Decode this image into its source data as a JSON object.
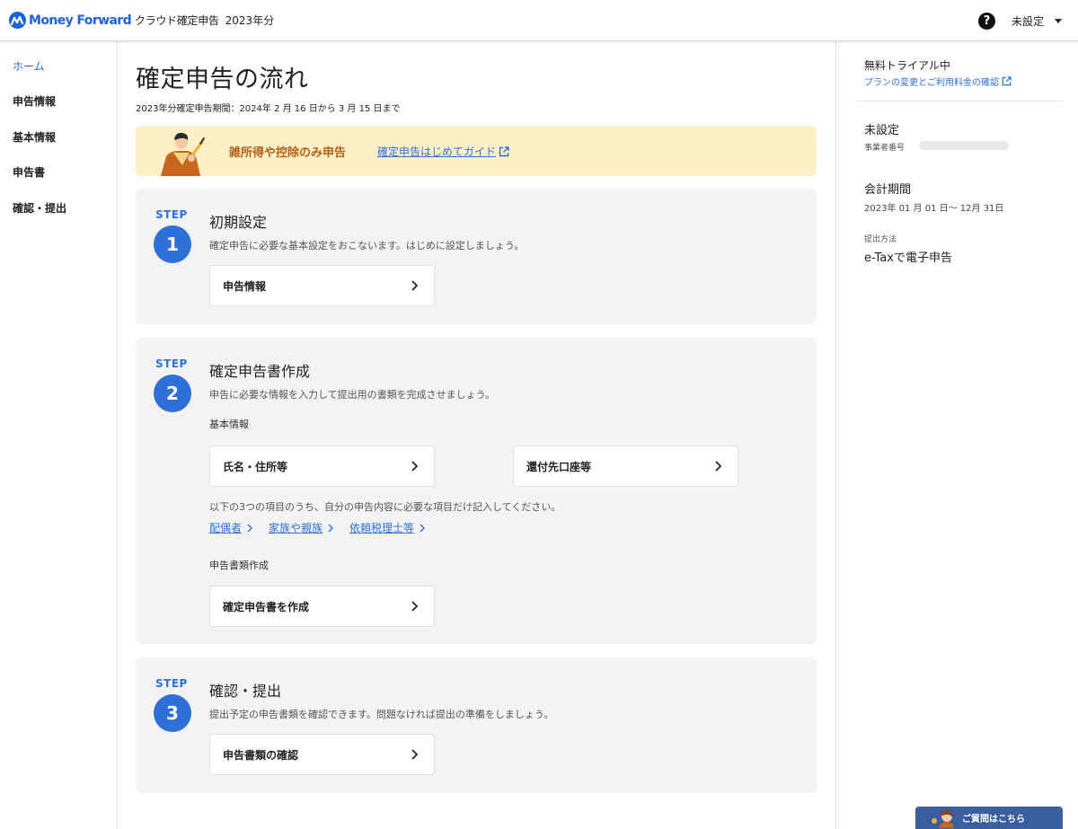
{
  "header": {
    "brand": "Money Forward",
    "product": "クラウド確定申告",
    "year": "2023年分",
    "help_icon": "question-circle-icon",
    "user": "未設定"
  },
  "sidebar": {
    "items": [
      {
        "label": "ホーム",
        "active": true
      },
      {
        "label": "申告情報",
        "active": false
      },
      {
        "label": "基本情報",
        "active": false
      },
      {
        "label": "申告書",
        "active": false
      },
      {
        "label": "確認・提出",
        "active": false
      }
    ]
  },
  "main": {
    "title": "確定申告の流れ",
    "period": "2023年分確定申告期間：2024年 2 月 16 日から 3 月 15 日まで",
    "banner": {
      "title": "雑所得や控除のみ申告",
      "link": "確定申告はじめてガイド"
    },
    "steps": [
      {
        "label": "STEP",
        "number": "1",
        "title": "初期設定",
        "desc": "確定申告に必要な基本設定をおこないます。はじめに設定しましょう。",
        "button": "申告情報"
      },
      {
        "label": "STEP",
        "number": "2",
        "title": "確定申告書作成",
        "desc": "申告に必要な情報を入力して提出用の書類を完成させましょう。",
        "basic_label": "基本情報",
        "button_name": "氏名・住所等",
        "button_refund": "還付先口座等",
        "optional_note": "以下の3つの項目のうち、自分の申告内容に必要な項目だけ記入してください。",
        "links": [
          "配偶者",
          "家族や親族",
          "依頼税理士等"
        ],
        "doc_label": "申告書類作成",
        "button_create": "確定申告書を作成"
      },
      {
        "label": "STEP",
        "number": "3",
        "title": "確認・提出",
        "desc": "提出予定の申告書類を確認できます。問題なければ提出の準備をしましょう。",
        "button": "申告書類の確認"
      }
    ]
  },
  "right": {
    "trial_title": "無料トライアル中",
    "trial_link": "プランの変更とご利用料金の確認",
    "business_name": "未設定",
    "business_number_label": "事業者番号",
    "fiscal_title": "会計期間",
    "fiscal_value": "2023年 01 月 01 日〜 12月 31日",
    "method_label": "提出方法",
    "method_value": "e-Taxで電子申告"
  },
  "floating_help": {
    "label": "ご質問はこちら"
  },
  "colors": {
    "brand_blue": "#1d63d8",
    "link_blue": "#2f71d9",
    "banner_bg": "#fdefc6",
    "banner_text": "#b5611b",
    "card_bg": "#f3f3f3"
  }
}
